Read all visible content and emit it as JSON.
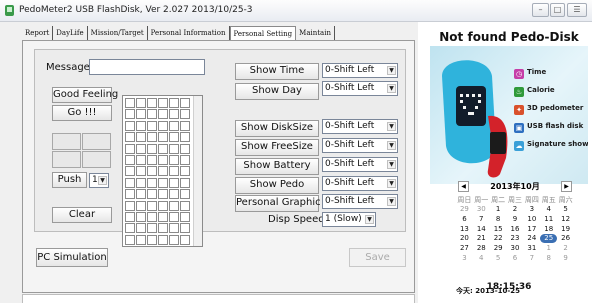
{
  "window": {
    "title": "PedoMeter2 USB FlashDisk, Ver 2.027  2013/10/25-3",
    "minimize": "–",
    "maximize": "□",
    "close": "☰"
  },
  "tabs": [
    {
      "label": "Report"
    },
    {
      "label": "DayLife"
    },
    {
      "label": "Mission/Target"
    },
    {
      "label": "Personal Information"
    },
    {
      "label": "Personal Setting"
    },
    {
      "label": "Maintain"
    }
  ],
  "message": {
    "label": "Message",
    "value": ""
  },
  "left_buttons": {
    "good_feeling": "Good Feeling",
    "go": "Go !!!",
    "push": "Push",
    "push_value": "1",
    "clear": "Clear"
  },
  "settings": [
    {
      "button": "Show Time",
      "value": "0-Shift Left"
    },
    {
      "button": "Show Day",
      "value": "0-Shift Left"
    },
    {
      "button": "Show DiskSize",
      "value": "0-Shift Left"
    },
    {
      "button": "Show FreeSize",
      "value": "0-Shift Left"
    },
    {
      "button": "Show Battery",
      "value": "0-Shift Left"
    },
    {
      "button": "Show Pedo",
      "value": "0-Shift Left"
    },
    {
      "button": "Personal Graphic",
      "value": "0-Shift Left"
    }
  ],
  "disp_speed": {
    "label": "Disp Speed",
    "value": "1 (Slow)"
  },
  "footer": {
    "pc_simulation": "PC Simulation",
    "save": "Save"
  },
  "right_panel": {
    "title": "Not found Pedo-Disk",
    "features": [
      {
        "label": "Time",
        "icon": "clock-icon",
        "color": "#c53ea8"
      },
      {
        "label": "Calorie",
        "icon": "flame-icon",
        "color": "#2f9a3a"
      },
      {
        "label": "3D pedometer",
        "icon": "walker-icon",
        "color": "#d9512c"
      },
      {
        "label": "USB flash disk",
        "icon": "usb-icon",
        "color": "#2e6fc0"
      },
      {
        "label": "Signature show",
        "icon": "cloud-icon",
        "color": "#3aa0d8"
      }
    ],
    "calendar": {
      "month": "2013年10月",
      "prev": "◀",
      "next": "▶",
      "weekdays": [
        "周日",
        "周一",
        "周二",
        "周三",
        "周四",
        "周五",
        "周六"
      ],
      "weeks": [
        [
          "29",
          "30",
          "1",
          "2",
          "3",
          "4",
          "5"
        ],
        [
          "6",
          "7",
          "8",
          "9",
          "10",
          "11",
          "12"
        ],
        [
          "13",
          "14",
          "15",
          "16",
          "17",
          "18",
          "19"
        ],
        [
          "20",
          "21",
          "22",
          "23",
          "24",
          "25",
          "26"
        ],
        [
          "27",
          "28",
          "29",
          "30",
          "31",
          "1",
          "2"
        ],
        [
          "3",
          "4",
          "5",
          "6",
          "7",
          "8",
          "9"
        ]
      ],
      "today_label": "今天: 2013-10-25",
      "today_day": "25"
    },
    "clock": "18:15:36"
  }
}
